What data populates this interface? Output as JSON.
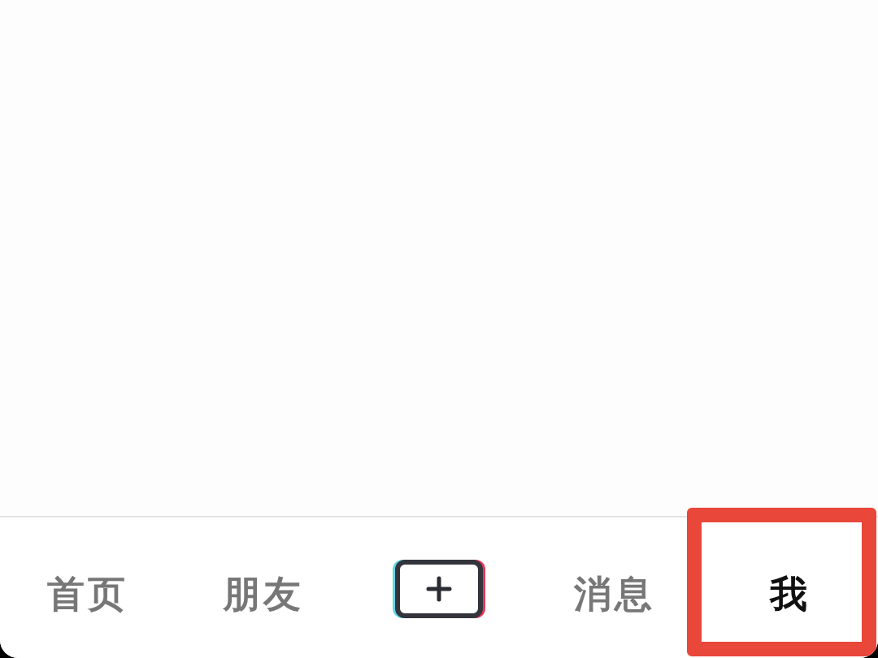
{
  "tab_bar": {
    "tabs": [
      {
        "kind": "label",
        "label": "首页",
        "selected": false,
        "highlighted": false
      },
      {
        "kind": "label",
        "label": "朋友",
        "selected": false,
        "highlighted": false
      },
      {
        "kind": "create",
        "selected": false,
        "highlighted": false
      },
      {
        "kind": "label",
        "label": "消息",
        "selected": false,
        "highlighted": false
      },
      {
        "kind": "label",
        "label": "我",
        "selected": true,
        "highlighted": true
      }
    ]
  }
}
